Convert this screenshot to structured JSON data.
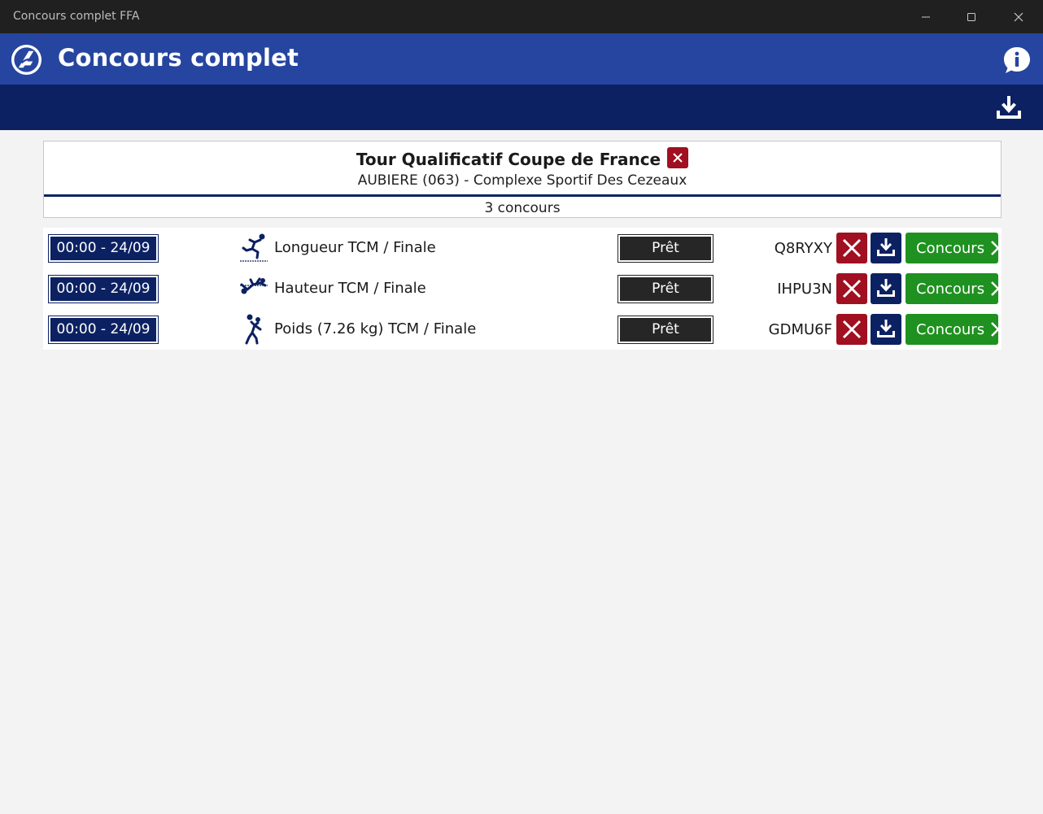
{
  "window": {
    "title": "Concours complet FFA",
    "controls": [
      "minimize-icon",
      "maximize-icon",
      "close-icon"
    ]
  },
  "header": {
    "title": "Concours complet",
    "logo_icon": "ffa-athletics-logo-icon",
    "info_icon": "info-icon",
    "color": "#2645a0"
  },
  "toolbar": {
    "download_icon": "download-icon",
    "color": "#0c2162"
  },
  "meeting": {
    "title": "Tour Qualificatif Coupe de France",
    "location": "AUBIERE (063) - Complexe Sportif Des Cezeaux",
    "count": "3 concours"
  },
  "competitions": [
    {
      "time": "00:00 - 24/09",
      "icon": "long-jump-icon",
      "name": "Longueur TCM / Finale",
      "status": "Prêt",
      "code": "Q8RYXY",
      "action_label": "Concours"
    },
    {
      "time": "00:00 - 24/09",
      "icon": "high-jump-icon",
      "name": "Hauteur TCM / Finale",
      "status": "Prêt",
      "code": "IHPU3N",
      "action_label": "Concours"
    },
    {
      "time": "00:00 - 24/09",
      "icon": "shot-put-icon",
      "name": "Poids (7.26 kg) TCM / Finale",
      "status": "Prêt",
      "code": "GDMU6F",
      "action_label": "Concours"
    }
  ],
  "colors": {
    "delete": "#a01020",
    "download": "#0c2162",
    "action": "#1f9120",
    "status": "#262626"
  }
}
